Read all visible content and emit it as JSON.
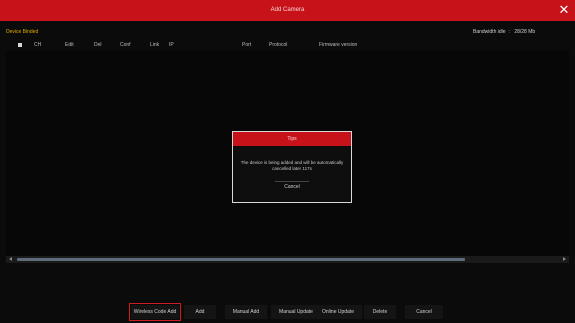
{
  "window": {
    "title": "Add Camera",
    "close_glyph": "✕",
    "titlebar_color": "#c8121a"
  },
  "device_binded_label": "Device Binded",
  "bandwidth": {
    "label": "Bandwidth idle",
    "separator": ":",
    "value": "28/28 Mb"
  },
  "table": {
    "headers": [
      "CH",
      "Edit",
      "Del",
      "Conf",
      "Link",
      "IP",
      "Port",
      "Protocol",
      "Firmware version"
    ]
  },
  "dialog": {
    "title": "Tips",
    "message": "The device is being added and will be automatically cancelled later 117s",
    "cancel_label": "Cancel"
  },
  "bottom_buttons": [
    "Wireless Code Add",
    "Add",
    "Manual Add",
    "Manual Update",
    "Online Update",
    "Delete",
    "Cancel"
  ],
  "accent_color": "#d01b22"
}
